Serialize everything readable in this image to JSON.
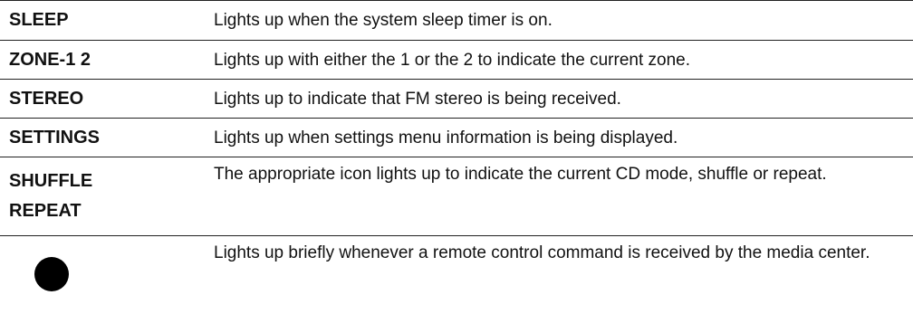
{
  "rows": [
    {
      "label": "SLEEP",
      "description": "Lights up when the system sleep timer is on."
    },
    {
      "label": "ZONE-1 2",
      "description": "Lights up with either the 1 or the 2 to indicate the current zone."
    },
    {
      "label": "STEREO",
      "description": "Lights up to indicate that FM stereo is being received."
    },
    {
      "label": "SETTINGS",
      "description": "Lights up when settings menu information is being displayed."
    },
    {
      "label_lines": [
        "SHUFFLE",
        "REPEAT"
      ],
      "description": "The appropriate icon lights up to indicate the current CD mode, shuffle or repeat."
    },
    {
      "icon": "filled-circle-icon",
      "description": "Lights up briefly whenever a remote control command is received by the media center."
    }
  ]
}
